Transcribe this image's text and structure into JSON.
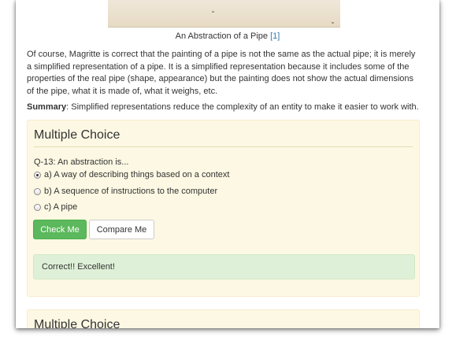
{
  "figure": {
    "caption": "An Abstraction of a Pipe",
    "ref_link": "[1]"
  },
  "paragraph": "Of course, Magritte is correct that the painting of a pipe is not the same as the actual pipe; it is merely a simplified representation of a pipe. It is a simplified representation because it includes some of the properties of the real pipe (shape, appearance) but the painting does not show the actual dimensions of the pipe, what it is made of, what it weighs, etc.",
  "summary": {
    "label": "Summary",
    "text": ": Simplified representations reduce the complexity of an entity to make it easier to work with."
  },
  "mc1": {
    "title": "Multiple Choice",
    "question": "Q-13: An abstraction is...",
    "options": [
      {
        "label": "a) A way of describing things based on a context",
        "checked": true
      },
      {
        "label": "b) A sequence of instructions to the computer",
        "checked": false
      },
      {
        "label": "c) A pipe",
        "checked": false
      }
    ],
    "check_button": "Check Me",
    "compare_button": "Compare Me",
    "feedback": "Correct!! Excellent!"
  },
  "mc2": {
    "title": "Multiple Choice"
  },
  "colors": {
    "panel_bg": "#fcf8e3",
    "check_button_bg": "#5cb85c",
    "feedback_bg": "#dff0d8",
    "link": "#337ab7"
  }
}
